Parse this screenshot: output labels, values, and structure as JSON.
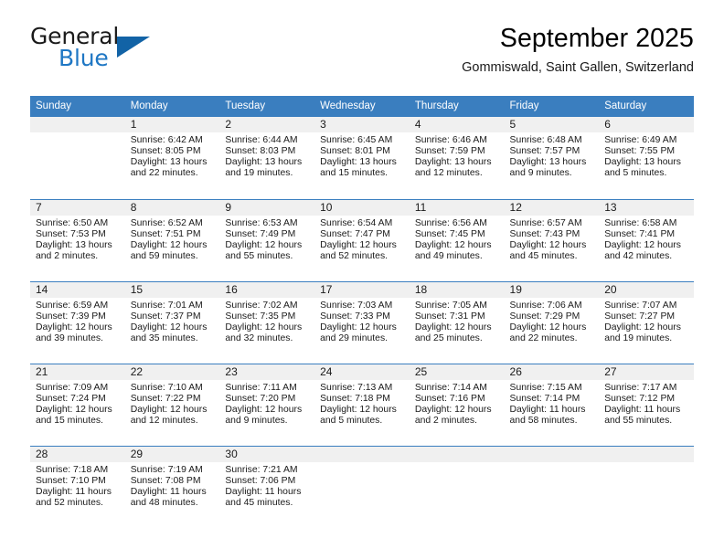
{
  "brand": {
    "name_part1": "General",
    "name_part2": "Blue",
    "logo_icon": "triangle-logo-icon"
  },
  "header": {
    "title": "September 2025",
    "subtitle": "Gommiswald, Saint Gallen, Switzerland"
  },
  "colors": {
    "header_row_bg": "#3a7ebf",
    "brand_blue": "#1f77c4",
    "logo_blue": "#1263a6",
    "daynum_strip_bg": "#f0f0f0",
    "cell_bg": "#ffffff",
    "text": "#1a1a1a"
  },
  "calendar": {
    "weekday_headers": [
      "Sunday",
      "Monday",
      "Tuesday",
      "Wednesday",
      "Thursday",
      "Friday",
      "Saturday"
    ],
    "weeks": [
      [
        {
          "day": "",
          "sunrise": "",
          "sunset": "",
          "daylight_line1": "",
          "daylight_line2": ""
        },
        {
          "day": "1",
          "sunrise": "Sunrise: 6:42 AM",
          "sunset": "Sunset: 8:05 PM",
          "daylight_line1": "Daylight: 13 hours",
          "daylight_line2": "and 22 minutes."
        },
        {
          "day": "2",
          "sunrise": "Sunrise: 6:44 AM",
          "sunset": "Sunset: 8:03 PM",
          "daylight_line1": "Daylight: 13 hours",
          "daylight_line2": "and 19 minutes."
        },
        {
          "day": "3",
          "sunrise": "Sunrise: 6:45 AM",
          "sunset": "Sunset: 8:01 PM",
          "daylight_line1": "Daylight: 13 hours",
          "daylight_line2": "and 15 minutes."
        },
        {
          "day": "4",
          "sunrise": "Sunrise: 6:46 AM",
          "sunset": "Sunset: 7:59 PM",
          "daylight_line1": "Daylight: 13 hours",
          "daylight_line2": "and 12 minutes."
        },
        {
          "day": "5",
          "sunrise": "Sunrise: 6:48 AM",
          "sunset": "Sunset: 7:57 PM",
          "daylight_line1": "Daylight: 13 hours",
          "daylight_line2": "and 9 minutes."
        },
        {
          "day": "6",
          "sunrise": "Sunrise: 6:49 AM",
          "sunset": "Sunset: 7:55 PM",
          "daylight_line1": "Daylight: 13 hours",
          "daylight_line2": "and 5 minutes."
        }
      ],
      [
        {
          "day": "7",
          "sunrise": "Sunrise: 6:50 AM",
          "sunset": "Sunset: 7:53 PM",
          "daylight_line1": "Daylight: 13 hours",
          "daylight_line2": "and 2 minutes."
        },
        {
          "day": "8",
          "sunrise": "Sunrise: 6:52 AM",
          "sunset": "Sunset: 7:51 PM",
          "daylight_line1": "Daylight: 12 hours",
          "daylight_line2": "and 59 minutes."
        },
        {
          "day": "9",
          "sunrise": "Sunrise: 6:53 AM",
          "sunset": "Sunset: 7:49 PM",
          "daylight_line1": "Daylight: 12 hours",
          "daylight_line2": "and 55 minutes."
        },
        {
          "day": "10",
          "sunrise": "Sunrise: 6:54 AM",
          "sunset": "Sunset: 7:47 PM",
          "daylight_line1": "Daylight: 12 hours",
          "daylight_line2": "and 52 minutes."
        },
        {
          "day": "11",
          "sunrise": "Sunrise: 6:56 AM",
          "sunset": "Sunset: 7:45 PM",
          "daylight_line1": "Daylight: 12 hours",
          "daylight_line2": "and 49 minutes."
        },
        {
          "day": "12",
          "sunrise": "Sunrise: 6:57 AM",
          "sunset": "Sunset: 7:43 PM",
          "daylight_line1": "Daylight: 12 hours",
          "daylight_line2": "and 45 minutes."
        },
        {
          "day": "13",
          "sunrise": "Sunrise: 6:58 AM",
          "sunset": "Sunset: 7:41 PM",
          "daylight_line1": "Daylight: 12 hours",
          "daylight_line2": "and 42 minutes."
        }
      ],
      [
        {
          "day": "14",
          "sunrise": "Sunrise: 6:59 AM",
          "sunset": "Sunset: 7:39 PM",
          "daylight_line1": "Daylight: 12 hours",
          "daylight_line2": "and 39 minutes."
        },
        {
          "day": "15",
          "sunrise": "Sunrise: 7:01 AM",
          "sunset": "Sunset: 7:37 PM",
          "daylight_line1": "Daylight: 12 hours",
          "daylight_line2": "and 35 minutes."
        },
        {
          "day": "16",
          "sunrise": "Sunrise: 7:02 AM",
          "sunset": "Sunset: 7:35 PM",
          "daylight_line1": "Daylight: 12 hours",
          "daylight_line2": "and 32 minutes."
        },
        {
          "day": "17",
          "sunrise": "Sunrise: 7:03 AM",
          "sunset": "Sunset: 7:33 PM",
          "daylight_line1": "Daylight: 12 hours",
          "daylight_line2": "and 29 minutes."
        },
        {
          "day": "18",
          "sunrise": "Sunrise: 7:05 AM",
          "sunset": "Sunset: 7:31 PM",
          "daylight_line1": "Daylight: 12 hours",
          "daylight_line2": "and 25 minutes."
        },
        {
          "day": "19",
          "sunrise": "Sunrise: 7:06 AM",
          "sunset": "Sunset: 7:29 PM",
          "daylight_line1": "Daylight: 12 hours",
          "daylight_line2": "and 22 minutes."
        },
        {
          "day": "20",
          "sunrise": "Sunrise: 7:07 AM",
          "sunset": "Sunset: 7:27 PM",
          "daylight_line1": "Daylight: 12 hours",
          "daylight_line2": "and 19 minutes."
        }
      ],
      [
        {
          "day": "21",
          "sunrise": "Sunrise: 7:09 AM",
          "sunset": "Sunset: 7:24 PM",
          "daylight_line1": "Daylight: 12 hours",
          "daylight_line2": "and 15 minutes."
        },
        {
          "day": "22",
          "sunrise": "Sunrise: 7:10 AM",
          "sunset": "Sunset: 7:22 PM",
          "daylight_line1": "Daylight: 12 hours",
          "daylight_line2": "and 12 minutes."
        },
        {
          "day": "23",
          "sunrise": "Sunrise: 7:11 AM",
          "sunset": "Sunset: 7:20 PM",
          "daylight_line1": "Daylight: 12 hours",
          "daylight_line2": "and 9 minutes."
        },
        {
          "day": "24",
          "sunrise": "Sunrise: 7:13 AM",
          "sunset": "Sunset: 7:18 PM",
          "daylight_line1": "Daylight: 12 hours",
          "daylight_line2": "and 5 minutes."
        },
        {
          "day": "25",
          "sunrise": "Sunrise: 7:14 AM",
          "sunset": "Sunset: 7:16 PM",
          "daylight_line1": "Daylight: 12 hours",
          "daylight_line2": "and 2 minutes."
        },
        {
          "day": "26",
          "sunrise": "Sunrise: 7:15 AM",
          "sunset": "Sunset: 7:14 PM",
          "daylight_line1": "Daylight: 11 hours",
          "daylight_line2": "and 58 minutes."
        },
        {
          "day": "27",
          "sunrise": "Sunrise: 7:17 AM",
          "sunset": "Sunset: 7:12 PM",
          "daylight_line1": "Daylight: 11 hours",
          "daylight_line2": "and 55 minutes."
        }
      ],
      [
        {
          "day": "28",
          "sunrise": "Sunrise: 7:18 AM",
          "sunset": "Sunset: 7:10 PM",
          "daylight_line1": "Daylight: 11 hours",
          "daylight_line2": "and 52 minutes."
        },
        {
          "day": "29",
          "sunrise": "Sunrise: 7:19 AM",
          "sunset": "Sunset: 7:08 PM",
          "daylight_line1": "Daylight: 11 hours",
          "daylight_line2": "and 48 minutes."
        },
        {
          "day": "30",
          "sunrise": "Sunrise: 7:21 AM",
          "sunset": "Sunset: 7:06 PM",
          "daylight_line1": "Daylight: 11 hours",
          "daylight_line2": "and 45 minutes."
        },
        {
          "day": "",
          "sunrise": "",
          "sunset": "",
          "daylight_line1": "",
          "daylight_line2": ""
        },
        {
          "day": "",
          "sunrise": "",
          "sunset": "",
          "daylight_line1": "",
          "daylight_line2": ""
        },
        {
          "day": "",
          "sunrise": "",
          "sunset": "",
          "daylight_line1": "",
          "daylight_line2": ""
        },
        {
          "day": "",
          "sunrise": "",
          "sunset": "",
          "daylight_line1": "",
          "daylight_line2": ""
        }
      ]
    ]
  }
}
